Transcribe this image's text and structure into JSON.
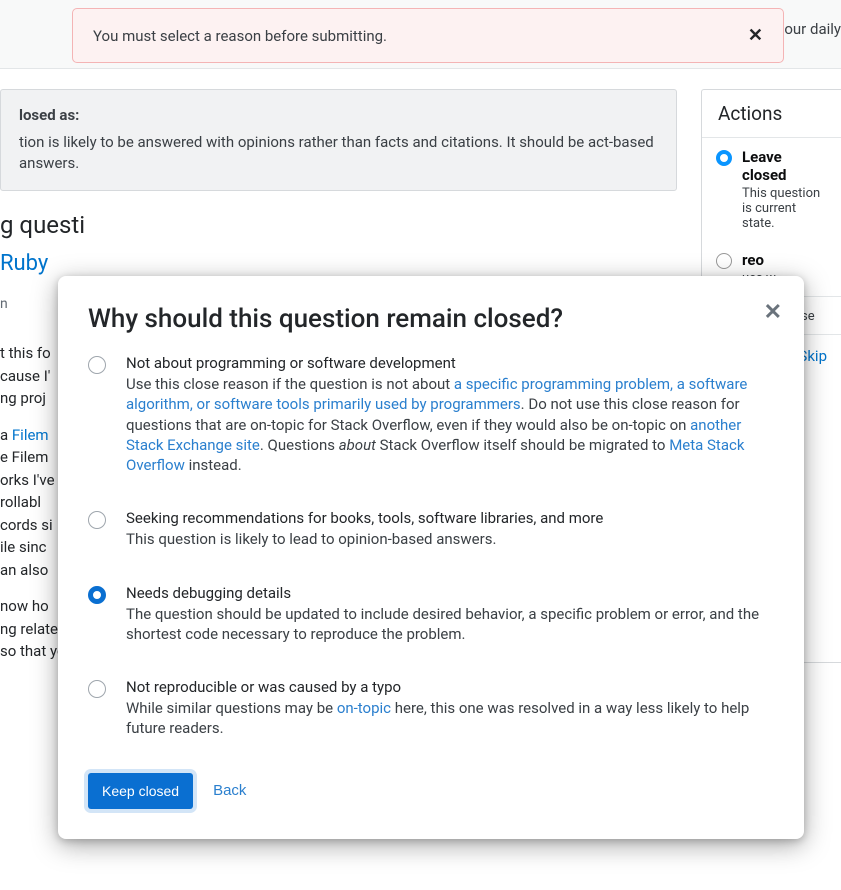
{
  "alert": {
    "text": "You must select a reason before submitting."
  },
  "header_right": "our daily",
  "closed_box": {
    "heading": "losed as:",
    "body": "tion is likely to be answered with opinions rather than facts and citations. It should be act-based answers."
  },
  "bg_title": "g questi",
  "bg_link": "Ruby",
  "sidebar": {
    "title": "Actions",
    "opt1_label": "Leave closed",
    "opt1_desc": "This question is current state.",
    "opt2_label": "reo",
    "opt2_desc": "ues w",
    "opt3_desc": "e been close",
    "skip": "Skip"
  },
  "bg_content": {
    "l1": "t this fo",
    "l2": "cause I'",
    "l3": "ng proj",
    "l4a": "a ",
    "l4link": "Filem",
    "l4b": "",
    "l5": "e Filem",
    "l6": "orks I've",
    "l7": "rollabl",
    "l8": "cords si",
    "l9": "ile sinc",
    "l10": "an also",
    "l11": "now ho",
    "l12": "ng related records and the recommended way to attach dynamic functionality",
    "l13": "so that you can perform functions on the related records directly from the"
  },
  "modal": {
    "title": "Why should this question remain closed?",
    "reasons": [
      {
        "title": "Not about programming or software development",
        "desc_pre": "Use this close reason if the question is not about ",
        "link1": "a specific programming problem, a software algorithm, or software tools primarily used by programmers",
        "desc_mid": ". Do not use this close reason for questions that are on-topic for Stack Overflow, even if they would also be on-topic on ",
        "link2": "another Stack Exchange site",
        "desc_mid2": ". Questions ",
        "em": "about",
        "desc_post": " Stack Overflow itself should be migrated to ",
        "link3": "Meta Stack Overflow",
        "desc_end": " instead.",
        "selected": false
      },
      {
        "title": "Seeking recommendations for books, tools, software libraries, and more",
        "desc": "This question is likely to lead to opinion-based answers.",
        "selected": false
      },
      {
        "title": "Needs debugging details",
        "desc": "The question should be updated to include desired behavior, a specific problem or error, and the shortest code necessary to reproduce the problem.",
        "selected": true
      },
      {
        "title": "Not reproducible or was caused by a typo",
        "desc_pre": "While similar questions may be ",
        "link1": "on-topic",
        "desc_post": " here, this one was resolved in a way less likely to help future readers.",
        "selected": false
      }
    ],
    "keep": "Keep closed",
    "back": "Back"
  }
}
